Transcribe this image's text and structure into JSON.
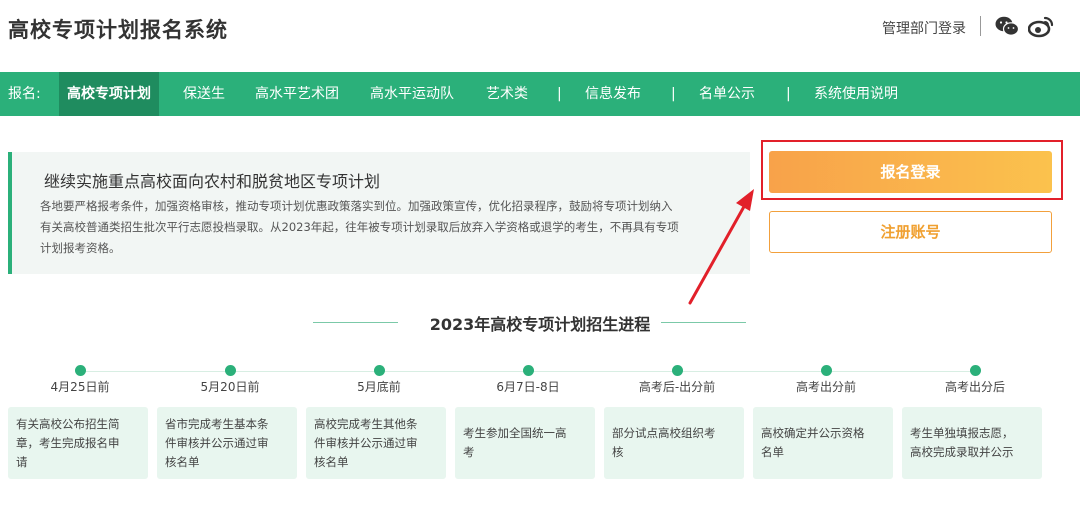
{
  "header": {
    "site_title": "高校专项计划报名系统",
    "admin_login": "管理部门登录",
    "icons": [
      "wechat-icon",
      "weibo-icon"
    ]
  },
  "nav": {
    "label": "报名:",
    "items": [
      "高校专项计划",
      "保送生",
      "高水平艺术团",
      "高水平运动队",
      "艺术类"
    ],
    "separator": "|",
    "links": [
      "信息发布",
      "名单公示",
      "系统使用说明"
    ]
  },
  "intro": {
    "title": "继续实施重点高校面向农村和脱贫地区专项计划",
    "lines": [
      "各地要严格报考条件，加强资格审核，推动专项计划优惠政策落实到位。加强政策宣传，优化招录程序，鼓励将专项计划纳入",
      "有关高校普通类招生批次平行志愿投档录取。从2023年起，往年被专项计划录取后放弃入学资格或退学的考生，不再具有专项",
      "计划报考资格。"
    ]
  },
  "actions": {
    "login": "报名登录",
    "register": "注册账号"
  },
  "progress": {
    "title": "2023年高校专项计划招生进程",
    "steps": [
      {
        "date": "4月25日前",
        "lines": [
          "有关高校公布招生简",
          "章，考生完成报名申",
          "请"
        ]
      },
      {
        "date": "5月20日前",
        "lines": [
          "省市完成考生基本条",
          "件审核并公示通过审",
          "核名单"
        ]
      },
      {
        "date": "5月底前",
        "lines": [
          "高校完成考生其他条",
          "件审核并公示通过审",
          "核名单"
        ]
      },
      {
        "date": "6月7日-8日",
        "lines": [
          "考生参加全国统一高",
          "考"
        ]
      },
      {
        "date": "高考后-出分前",
        "lines": [
          "部分试点高校组织考",
          "核"
        ]
      },
      {
        "date": "高考出分前",
        "lines": [
          "高校确定并公示资格",
          "名单"
        ]
      },
      {
        "date": "高考出分后",
        "lines": [
          "考生单独填报志愿，",
          "高校完成录取并公示"
        ]
      }
    ]
  },
  "colors": {
    "accent": "#2bb07a",
    "accent_dark": "#1f8c5f",
    "button_orange": "#f8a24a",
    "highlight_red": "#e2202a"
  }
}
